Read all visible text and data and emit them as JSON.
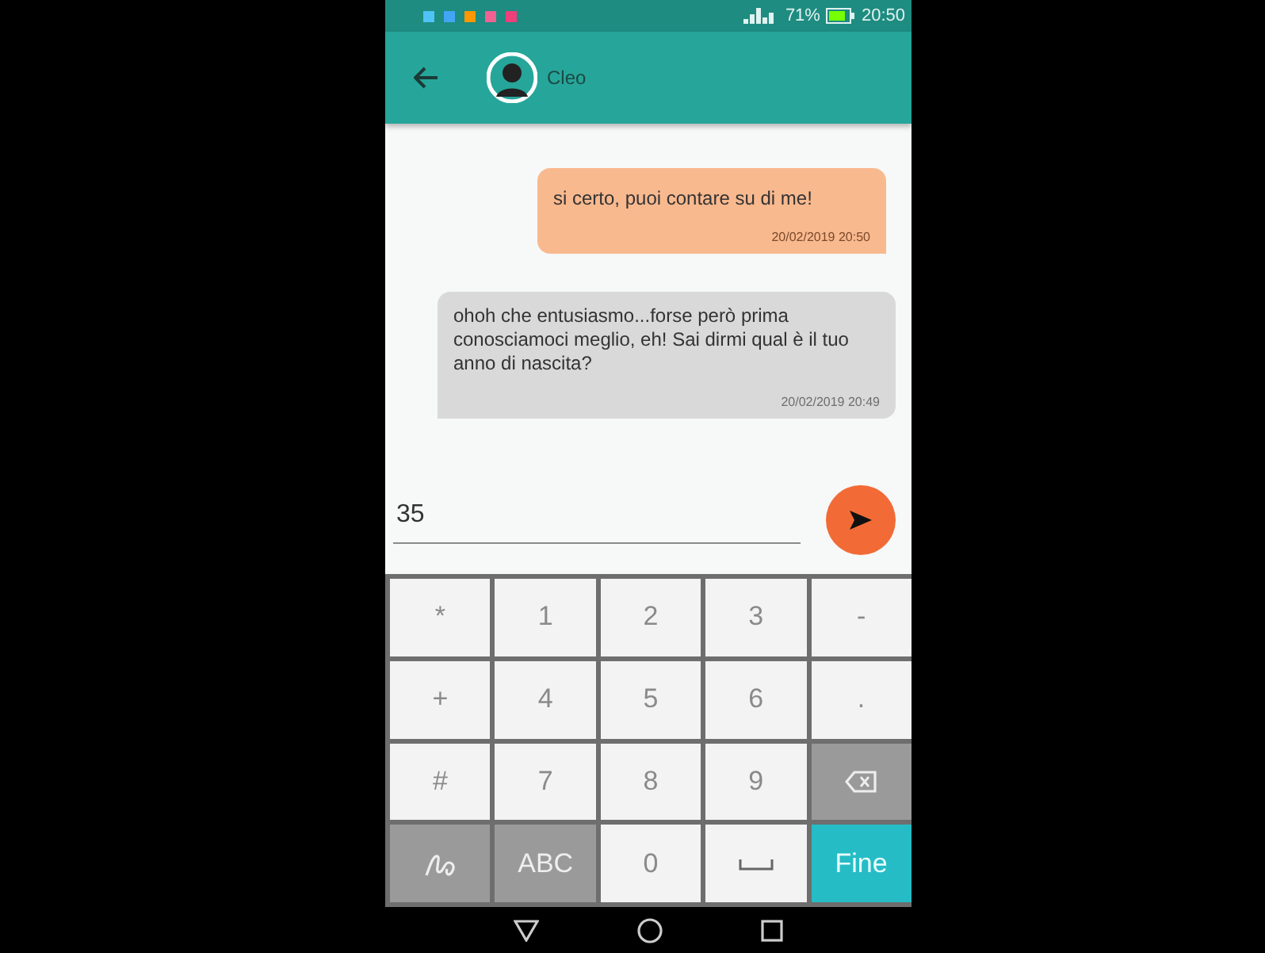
{
  "status_bar": {
    "battery": "71%",
    "time": "20:50"
  },
  "header": {
    "contact": "Cleo"
  },
  "messages": [
    {
      "kind": "sent",
      "text": "si certo, puoi contare su di me!",
      "time": "20/02/2019 20:50"
    },
    {
      "kind": "received",
      "text": "ohoh che entusiasmo...forse però prima conosciamoci meglio, eh! Sai dirmi qual è il tuo anno di nascita?",
      "time": "20/02/2019 20:49"
    }
  ],
  "composer": {
    "value": "35"
  },
  "keyboard": {
    "rows": [
      [
        {
          "kind": "key",
          "label": "*"
        },
        {
          "kind": "key",
          "label": "1"
        },
        {
          "kind": "key",
          "label": "2"
        },
        {
          "kind": "key",
          "label": "3"
        },
        {
          "kind": "key",
          "label": "-"
        }
      ],
      [
        {
          "kind": "key",
          "label": "+"
        },
        {
          "kind": "key",
          "label": "4"
        },
        {
          "kind": "key",
          "label": "5"
        },
        {
          "kind": "key",
          "label": "6"
        },
        {
          "kind": "key",
          "label": "."
        }
      ],
      [
        {
          "kind": "key",
          "label": "#"
        },
        {
          "kind": "key",
          "label": "7"
        },
        {
          "kind": "key",
          "label": "8"
        },
        {
          "kind": "key",
          "label": "9"
        },
        {
          "kind": "backspace"
        }
      ],
      [
        {
          "kind": "handwriting"
        },
        {
          "kind": "dark",
          "label": "ABC"
        },
        {
          "kind": "key",
          "label": "0"
        },
        {
          "kind": "space"
        },
        {
          "kind": "accent",
          "label": "Fine"
        }
      ]
    ]
  }
}
